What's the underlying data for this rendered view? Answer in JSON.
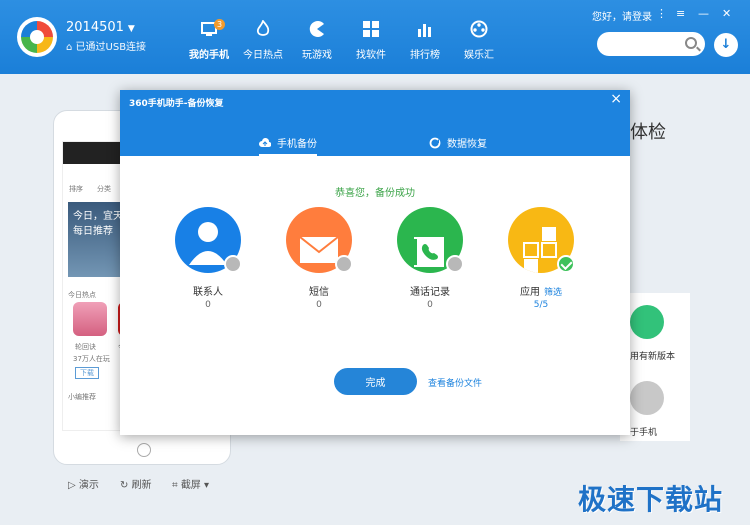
{
  "header": {
    "device_name": "2014501",
    "device_status": "已通过USB连接",
    "login_text": "您好，请登录",
    "nav": [
      {
        "label": "我的手机",
        "badge": "3"
      },
      {
        "label": "今日热点"
      },
      {
        "label": "玩游戏"
      },
      {
        "label": "找软件"
      },
      {
        "label": "排行榜"
      },
      {
        "label": "娱乐汇"
      }
    ]
  },
  "dialog": {
    "title": "360手机助手-备份恢复",
    "tabs": [
      "手机备份",
      "数据恢复"
    ],
    "success_message": "恭喜您，备份成功",
    "items": [
      {
        "label": "联系人",
        "count": "0"
      },
      {
        "label": "短信",
        "count": "0"
      },
      {
        "label": "通话记录",
        "count": "0"
      },
      {
        "label": "应用",
        "count": "5/5",
        "filter": "筛选"
      }
    ],
    "done_label": "完成",
    "view_link": "查看备份文件"
  },
  "phone_preview": {
    "tabs": [
      "排序",
      "分类"
    ],
    "banner_line1": "今日，宜天",
    "banner_line2": "每日推荐",
    "app_name_1": "轮回诀",
    "app_name_2": "今",
    "section_label": "今日热点",
    "app_downloads": "37万人在玩",
    "download_label": "下载",
    "recommend_label": "小编推荐"
  },
  "bottom_tools": [
    "演示",
    "刷新",
    "截屏"
  ],
  "right_panel": {
    "heading_partial": "体检",
    "item1": "用有新版本",
    "item2": "于手机"
  },
  "watermark": "极速下载站",
  "colors": {
    "primary_blue": "#1d83de",
    "success_green": "#3aa347",
    "contact_blue": "#1880e6",
    "sms_orange": "#ff7d3d",
    "calls_green": "#2bb64e",
    "apps_yellow": "#f8b814"
  }
}
